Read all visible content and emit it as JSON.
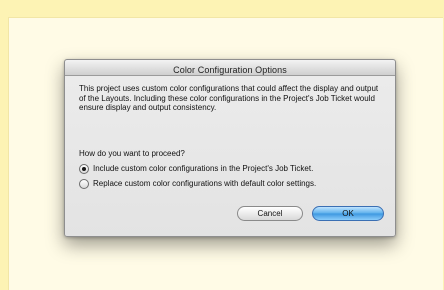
{
  "dialog": {
    "title": "Color Configuration Options",
    "message": "This project uses custom color configurations that could affect the display and output of the Layouts. Including these color configurations in the Project's Job Ticket would ensure display and output consistency.",
    "question": "How do you want to proceed?",
    "options": [
      {
        "label": "Include custom color configurations in the Project's Job Ticket.",
        "selected": true
      },
      {
        "label": "Replace custom color configurations with default color settings.",
        "selected": false
      }
    ],
    "buttons": {
      "cancel": "Cancel",
      "ok": "OK"
    }
  }
}
